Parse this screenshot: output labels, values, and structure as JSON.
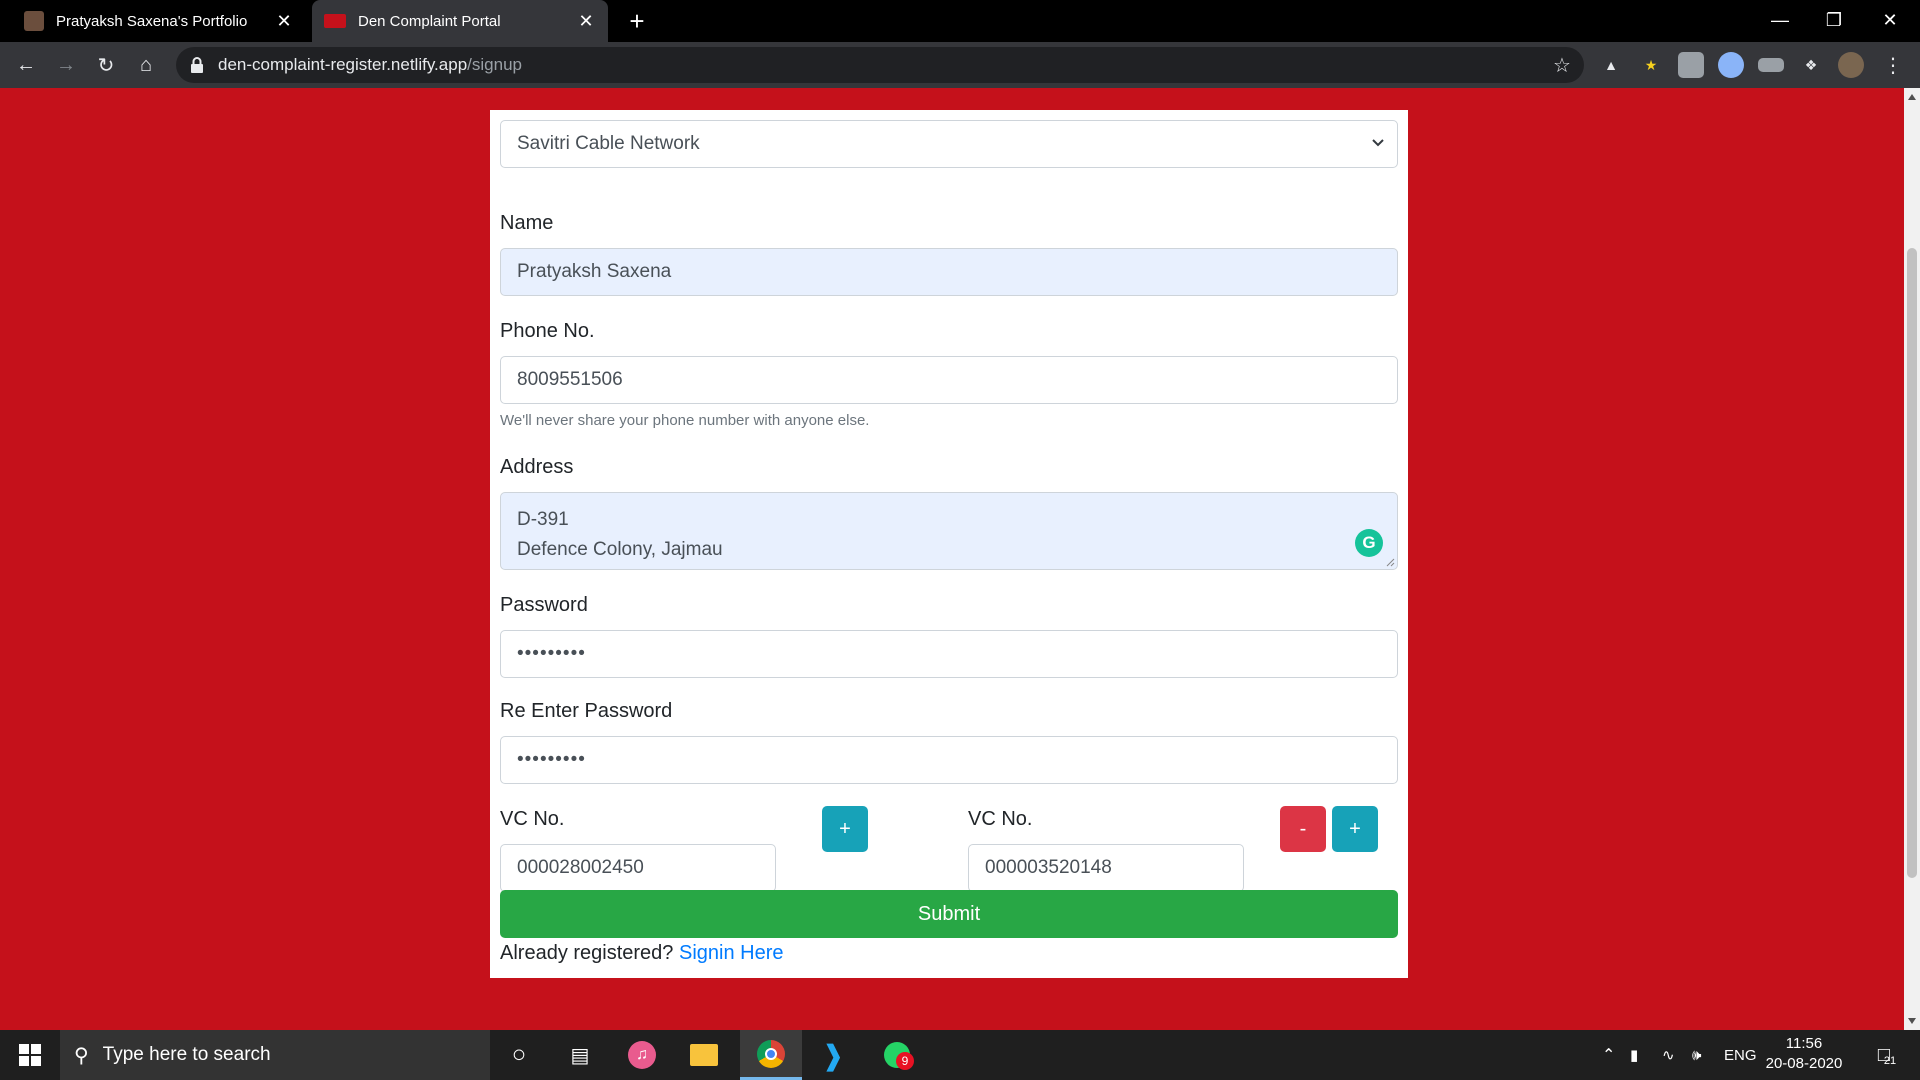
{
  "browser": {
    "tabs": [
      {
        "title": "Pratyaksh Saxena's Portfolio"
      },
      {
        "title": "Den Complaint Portal"
      }
    ],
    "url_host": "den-complaint-register.netlify.app",
    "url_path": "/signup"
  },
  "form": {
    "operator_selected": "Savitri Cable Network",
    "name_label": "Name",
    "name_value": "Pratyaksh Saxena",
    "phone_label": "Phone No.",
    "phone_value": "8009551506",
    "phone_hint": "We'll never share your phone number with anyone else.",
    "address_label": "Address",
    "address_line1": "D-391",
    "address_line2": "Defence Colony, Jajmau",
    "password_label": "Password",
    "password_value": "•••••••••",
    "reenter_label": "Re Enter Password",
    "reenter_value": "•••••••••",
    "vc1_label": "VC No.",
    "vc1_value": "000028002450",
    "vc2_label": "VC No.",
    "vc2_value": "000003520148",
    "add_label": "+",
    "remove_label": "-",
    "submit_label": "Submit",
    "already_text": "Already registered?",
    "signin_link": "Signin Here"
  },
  "taskbar": {
    "search_placeholder": "Type here to search",
    "language": "ENG",
    "time": "11:56",
    "date": "20-08-2020",
    "notification_count": "21",
    "whatsapp_badge": "9"
  },
  "colors": {
    "page_bg": "#c5111b",
    "submit": "#28a745",
    "info_button": "#17a2b8",
    "danger_button": "#dc3545",
    "link": "#007bff"
  }
}
